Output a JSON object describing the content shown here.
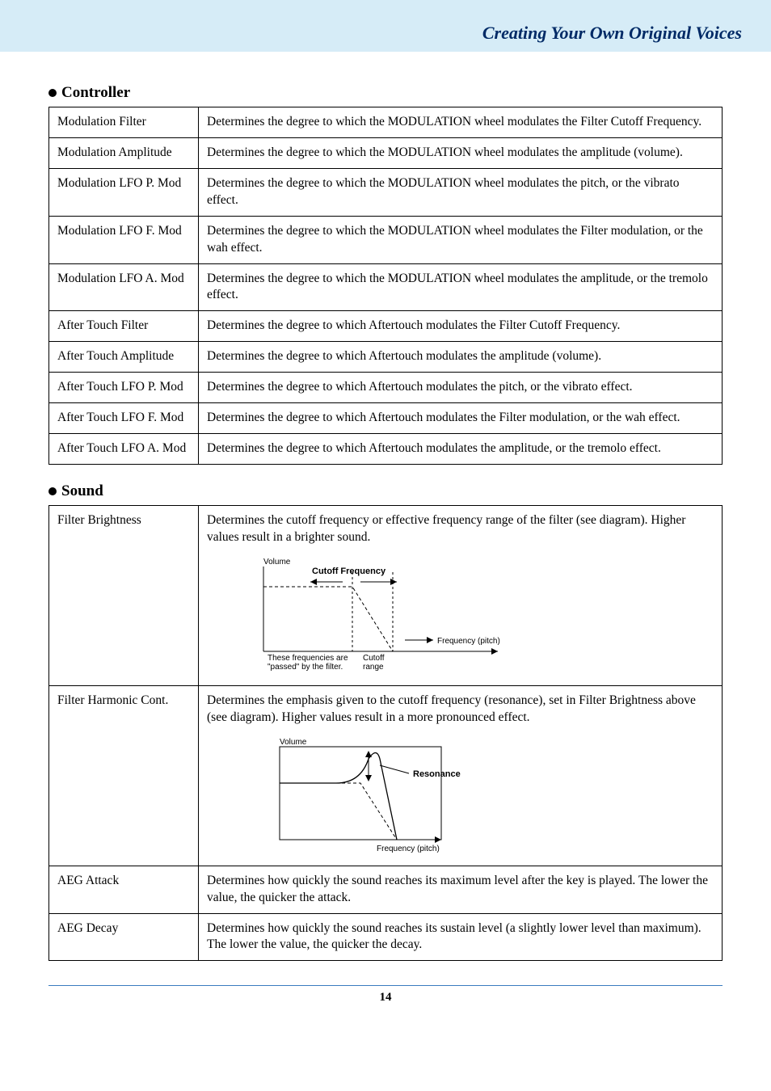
{
  "page": {
    "headerTitle": "Creating Your Own Original Voices",
    "footerPage": "14"
  },
  "sections": {
    "controller": {
      "heading": "Controller"
    },
    "sound": {
      "heading": "Sound"
    }
  },
  "controllerRows": [
    {
      "name": "Modulation Filter",
      "desc": "Determines the degree to which the MODULATION wheel modulates the Filter Cutoff Frequency."
    },
    {
      "name": "Modulation Amplitude",
      "desc": "Determines the degree to which the MODULATION wheel modulates the amplitude (volume)."
    },
    {
      "name": "Modulation LFO P. Mod",
      "desc": "Determines the degree to which the MODULATION wheel modulates the pitch, or the vibrato effect."
    },
    {
      "name": "Modulation LFO F. Mod",
      "desc": "Determines the degree to which the MODULATION wheel modulates the Filter modulation, or the wah effect."
    },
    {
      "name": "Modulation LFO A. Mod",
      "desc": "Determines the degree to which the MODULATION wheel modulates the amplitude, or the tremolo effect."
    },
    {
      "name": "After Touch Filter",
      "desc": "Determines the degree to which Aftertouch modulates the Filter Cutoff Frequency."
    },
    {
      "name": "After Touch Amplitude",
      "desc": "Determines the degree to which Aftertouch modulates the amplitude (volume)."
    },
    {
      "name": "After Touch LFO P. Mod",
      "desc": "Determines the degree to which Aftertouch modulates the pitch, or the vibrato effect."
    },
    {
      "name": "After Touch LFO F. Mod",
      "desc": "Determines the degree to which Aftertouch modulates the Filter modulation, or the wah effect."
    },
    {
      "name": "After Touch LFO A. Mod",
      "desc": "Determines the degree to which Aftertouch modulates the amplitude, or the tremolo effect."
    }
  ],
  "soundRows": {
    "filterBrightness": {
      "name": "Filter Brightness",
      "desc": "Determines the cutoff frequency or effective frequency range of the filter (see diagram). Higher values result in a brighter sound."
    },
    "filterHarmonic": {
      "name": "Filter Harmonic Cont.",
      "desc": "Determines the emphasis given to the cutoff frequency (resonance), set in Filter Brightness above (see diagram). Higher values result in a more pronounced effect."
    },
    "aegAttack": {
      "name": "AEG Attack",
      "desc": "Determines how quickly the sound reaches its maximum level after the key is played. The lower the value, the quicker the attack."
    },
    "aegDecay": {
      "name": "AEG Decay",
      "desc": "Determines how quickly the sound reaches its sustain level (a slightly lower level than maximum). The lower the value, the quicker the decay."
    }
  },
  "diagram1": {
    "volumeLabel": "Volume",
    "cutoffFreqLabel": "Cutoff Frequency",
    "passedLabel1": "These frequencies are",
    "passedLabel2": "\"passed\" by the filter.",
    "cutoffRange1": "Cutoff",
    "cutoffRange2": "range",
    "freqPitchLabel": "Frequency (pitch)"
  },
  "diagram2": {
    "volumeLabel": "Volume",
    "resonanceLabel": "Resonance",
    "freqPitchLabel": "Frequency (pitch)"
  }
}
